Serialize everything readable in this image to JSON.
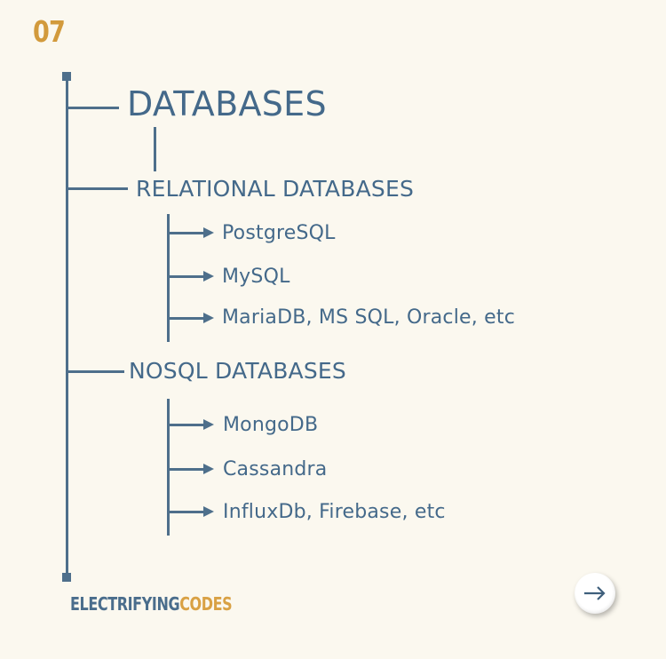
{
  "page_number": "07",
  "diagram": {
    "title": "DATABASES",
    "sections": [
      {
        "heading": "RELATIONAL DATABASES",
        "items": [
          "PostgreSQL",
          "MySQL",
          "MariaDB, MS SQL, Oracle, etc"
        ]
      },
      {
        "heading": "NOSQL DATABASES",
        "items": [
          "MongoDB",
          "Cassandra",
          "InfluxDb, Firebase, etc"
        ]
      }
    ]
  },
  "brand": {
    "part1": "ELECTRIFYING",
    "part2": "CODES"
  },
  "colors": {
    "background": "#fbf8ef",
    "text": "#44698a",
    "accent": "#d29a3c"
  },
  "next_button": {
    "icon": "arrow-right-icon"
  }
}
